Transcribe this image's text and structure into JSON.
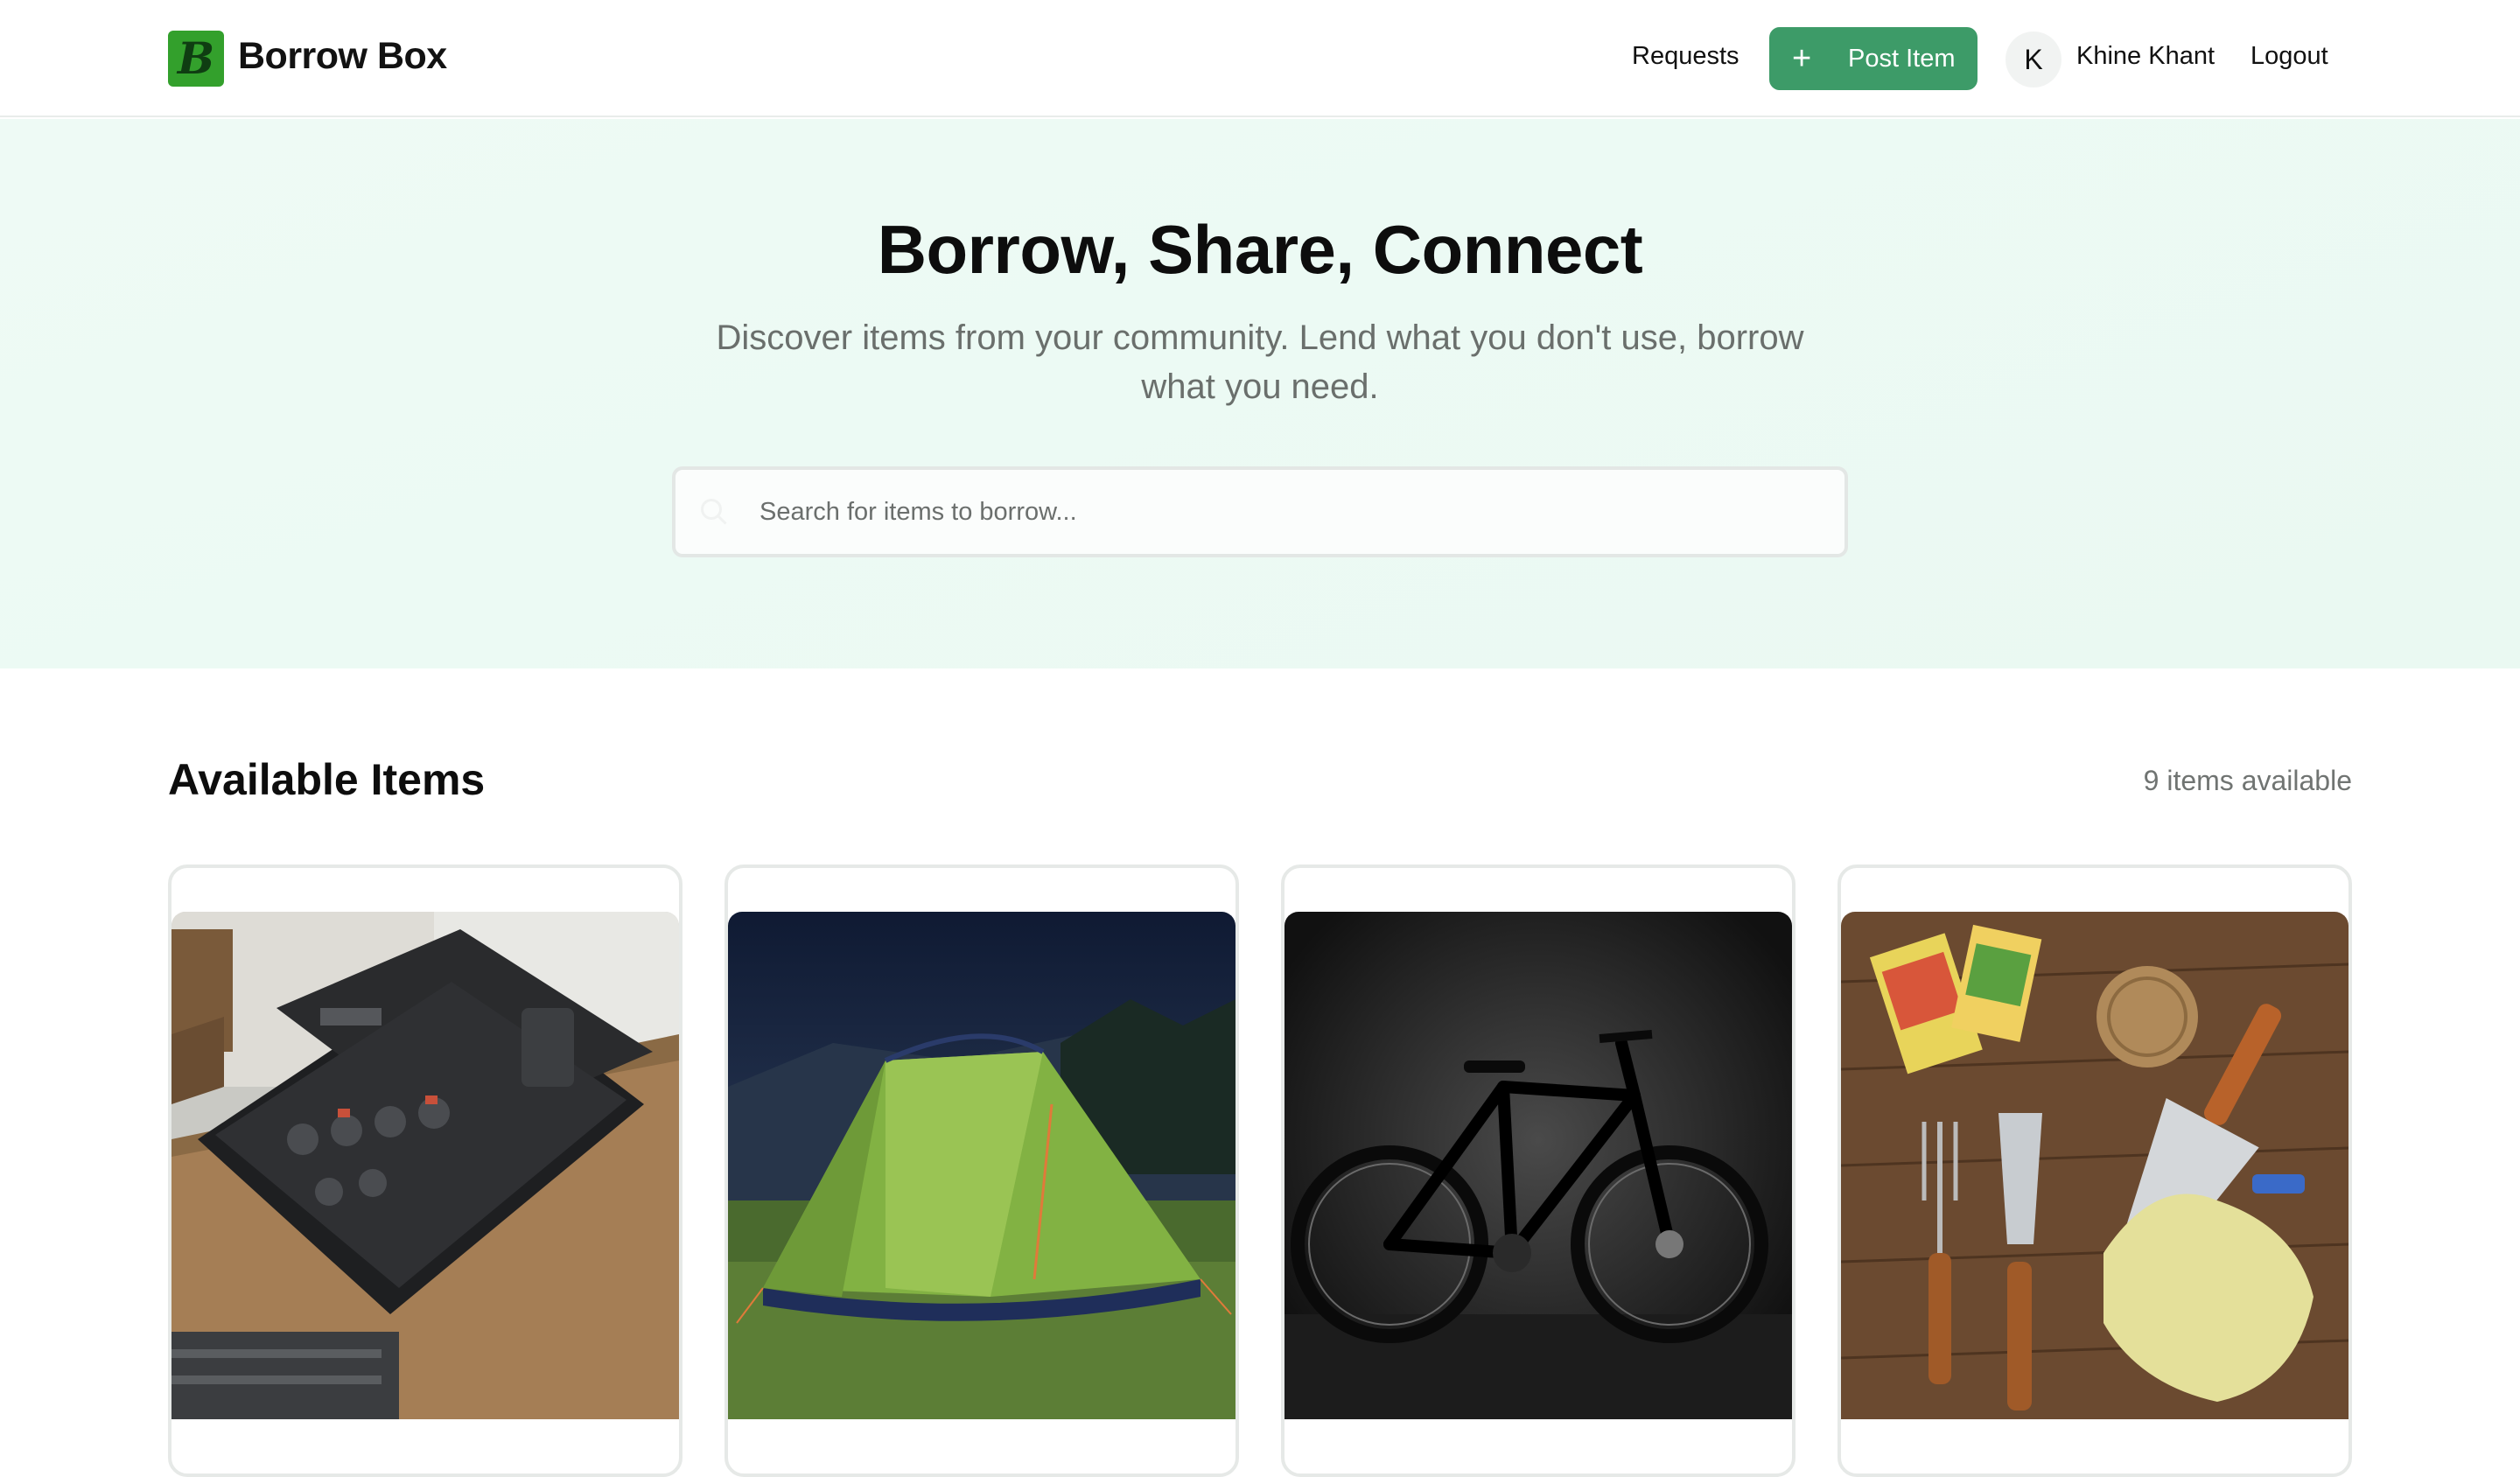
{
  "header": {
    "brand": "Borrow Box",
    "logo_letter": "B",
    "nav": {
      "requests": "Requests",
      "post_item": "Post Item",
      "avatar_initial": "K",
      "username": "Khine Khant",
      "logout": "Logout"
    }
  },
  "hero": {
    "title": "Borrow, Share, Connect",
    "subtitle": "Discover items from your community. Lend what you don't use, borrow what you need.",
    "search_placeholder": "Search for items to borrow..."
  },
  "items_section": {
    "title": "Available Items",
    "count_text": "9 items available",
    "cards": [
      {
        "image": "power-tool-kit"
      },
      {
        "image": "camping-tent"
      },
      {
        "image": "mountain-bike"
      },
      {
        "image": "gardening-tools"
      }
    ]
  },
  "colors": {
    "brand_green": "#33a02c",
    "button_green": "#3d9b68",
    "hero_bg": "#eefaf5"
  }
}
